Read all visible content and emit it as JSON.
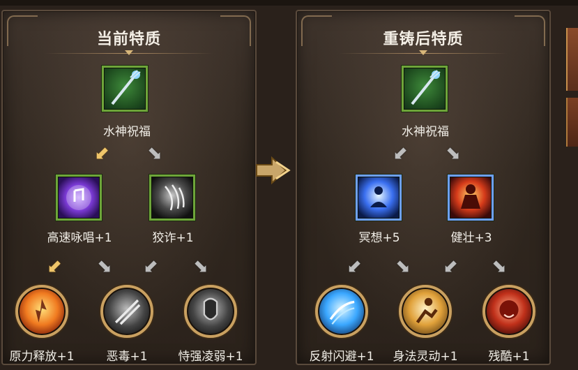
{
  "left_panel": {
    "title": "当前特质",
    "root": {
      "label": "水神祝福",
      "icon": "trident-staff-icon"
    },
    "mid": [
      {
        "label": "高速咏唱+1",
        "icon": "arcane-orb-icon"
      },
      {
        "label": "狡诈+1",
        "icon": "shadow-claw-icon"
      }
    ],
    "leaves": [
      {
        "label": "原力释放+1",
        "icon": "force-burst-icon"
      },
      {
        "label": "恶毒+1",
        "icon": "dark-slash-icon"
      },
      {
        "label": "恃强凌弱+1",
        "icon": "armored-knight-icon"
      }
    ]
  },
  "right_panel": {
    "title": "重铸后特质",
    "root": {
      "label": "水神祝福",
      "icon": "trident-staff-icon"
    },
    "mid": [
      {
        "label": "冥想+5",
        "icon": "meditation-icon"
      },
      {
        "label": "健壮+3",
        "icon": "strong-body-icon"
      }
    ],
    "leaves": [
      {
        "label": "反射闪避+1",
        "icon": "reflex-dodge-icon"
      },
      {
        "label": "身法灵动+1",
        "icon": "agile-movement-icon"
      },
      {
        "label": "残酷+1",
        "icon": "brutal-rage-icon"
      }
    ]
  },
  "colors": {
    "active_arrow": "#f0c66a",
    "inactive_arrow": "#bdbdbd",
    "label_text": "#f2efe8"
  }
}
